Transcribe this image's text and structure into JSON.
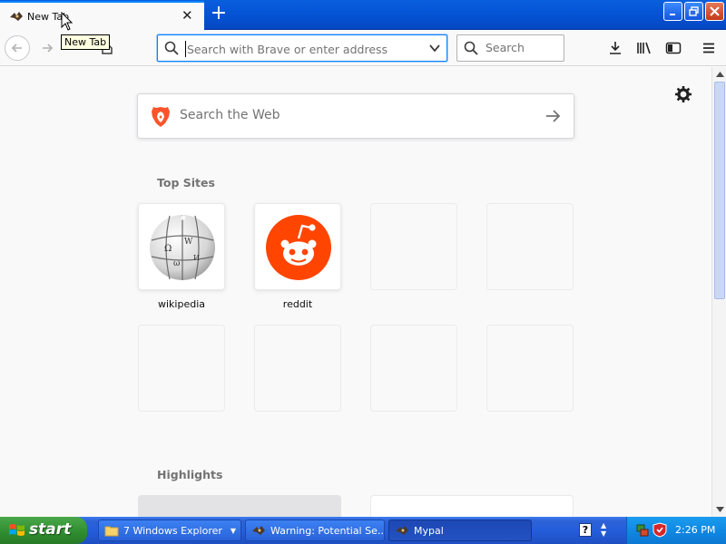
{
  "browser": {
    "tab": {
      "title": "New Tab",
      "tooltip": "New Tab"
    },
    "urlbar": {
      "placeholder": "Search with Brave or enter address"
    },
    "searchbar": {
      "placeholder": "Search"
    }
  },
  "newtab": {
    "websearch_placeholder": "Search the Web",
    "top_sites_title": "Top Sites",
    "top_sites": [
      {
        "label": "wikipedia",
        "icon": "wikipedia-icon"
      },
      {
        "label": "reddit",
        "icon": "reddit-icon"
      }
    ],
    "highlights_title": "Highlights"
  },
  "taskbar": {
    "start_label": "start",
    "tasks": [
      {
        "label": "7 Windows Explorer",
        "icon": "folder-icon"
      },
      {
        "label": "Warning: Potential Se...",
        "icon": "browser-icon"
      },
      {
        "label": "Mypal",
        "icon": "browser-icon"
      }
    ],
    "clock": "2:26 PM"
  },
  "colors": {
    "accent": "#0a84ff",
    "reddit": "#ff4500",
    "brave": "#fb542b",
    "xp_taskbar": "#245edb",
    "xp_start": "#3c9a3c"
  }
}
